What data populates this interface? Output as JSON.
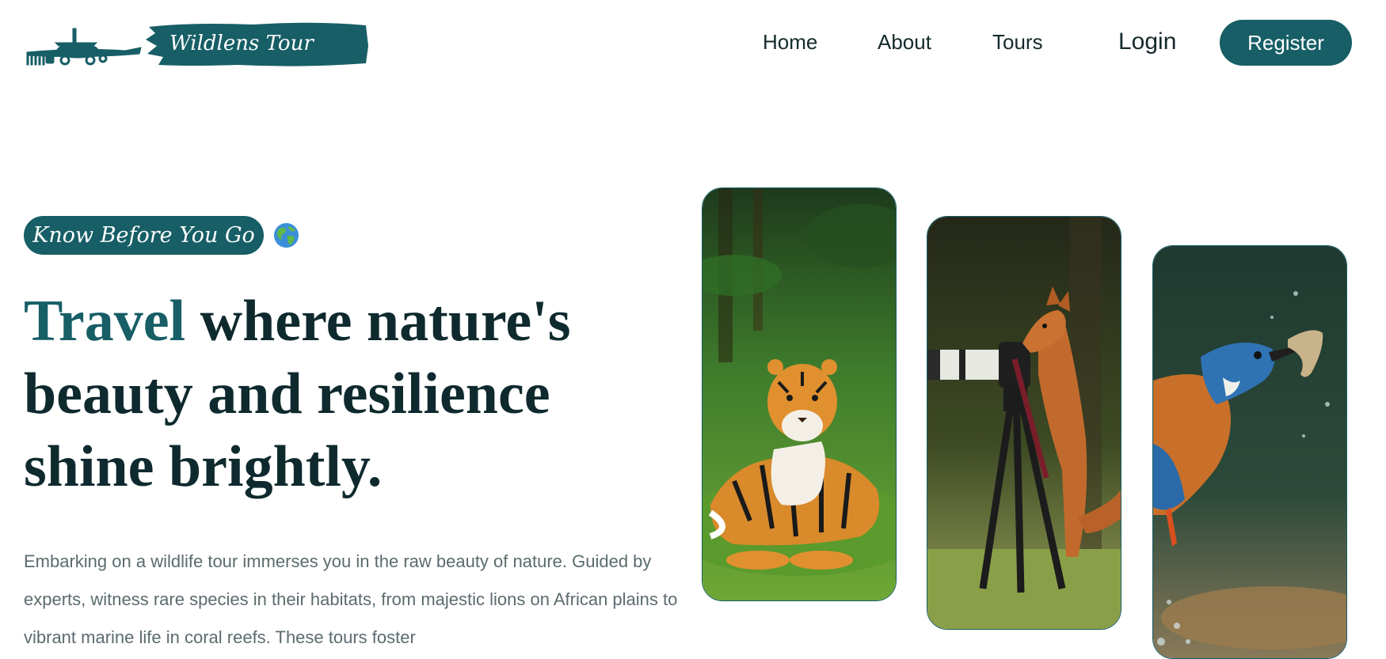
{
  "brand": {
    "name": "Wildlens Tour",
    "accent_color": "#175e66",
    "logo_icon": "airplane-icon"
  },
  "nav": {
    "home": "Home",
    "about": "About",
    "tours": "Tours",
    "login": "Login",
    "register": "Register"
  },
  "hero": {
    "tagline": "Know Before You Go",
    "tagline_icon": "globe-icon",
    "headline_accent": "Travel",
    "headline_rest": " where nature's beauty and resilience shine brightly.",
    "intro": "Embarking on a wildlife tour immerses you in the raw beauty of nature. Guided by experts, witness rare species in their habitats, from majestic lions on African plains to vibrant marine life in coral reefs. These tours foster"
  },
  "gallery": [
    {
      "subject": "tiger",
      "icon": "tiger-photo"
    },
    {
      "subject": "fox with camera",
      "icon": "fox-photo"
    },
    {
      "subject": "kingfisher",
      "icon": "kingfisher-photo"
    }
  ]
}
